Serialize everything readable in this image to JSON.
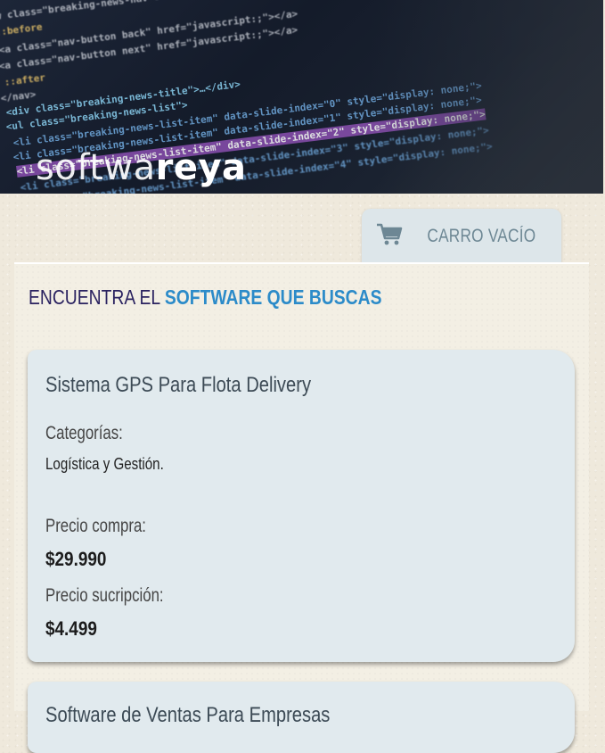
{
  "header": {
    "logo_light": "softwa",
    "logo_bold": "reya",
    "code_lines": [
      "w class=\"breaking-news-nav cf\">",
      "::before",
      "<a class=\"nav-button back\" href=\"javascript:;\"></a>",
      "<a class=\"nav-button next\" href=\"javascript:;\"></a>",
      "::after",
      "</nav>",
      "<div class=\"breaking-news-title\">…</div>",
      "<ul class=\"breaking-news-list\">",
      "<li class=\"breaking-news-list-item\" data-slide-index=\"0\" style=\"display: none;\">",
      "<li class=\"breaking-news-list-item\" data-slide-index=\"1\" style=\"display: none;\">",
      "<li class=\"breaking-news-list-item\" data-slide-index=\"2\" style=\"display: none;\">",
      "<li class=\"breaking-news-list-item\" data-slide-index=\"3\" style=\"display: none;\">",
      "<li class=\"breaking-news-list-item\" data-slide-index=\"4\" style=\"display: none;\">"
    ]
  },
  "cart": {
    "icon": "cart-icon",
    "label": "CARRO VACÍO"
  },
  "section": {
    "title_part1": "ENCUENTRA EL ",
    "title_part2": "SOFTWARE QUE BUSCAS"
  },
  "products": [
    {
      "name": "Sistema GPS Para Flota Delivery",
      "categories_label": "Categorías:",
      "categories": "Logística y Gestión.",
      "purchase_label": "Precio compra:",
      "purchase_price": "$29.990",
      "subscription_label": "Precio sucripción:",
      "subscription_price": "$4.499"
    },
    {
      "name": "Software de Ventas Para Empresas"
    }
  ],
  "colors": {
    "background": "#efe9dc",
    "accent_blue": "#2c8bc9",
    "title_dark": "#2a2260",
    "card_bg": "#e1eaee",
    "cart_bg": "#dde6ea",
    "cart_text": "#6d8794"
  }
}
